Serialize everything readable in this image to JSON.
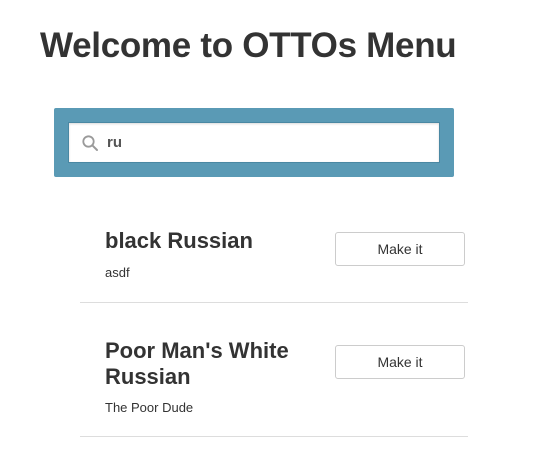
{
  "header": {
    "title": "Welcome to OTTOs Menu"
  },
  "search": {
    "icon": "search-icon",
    "value": "ru",
    "placeholder": ""
  },
  "results": [
    {
      "title": "black Russian",
      "description": "asdf",
      "button_label": "Make it"
    },
    {
      "title": "Poor Man's White Russian",
      "description": "The Poor Dude",
      "button_label": "Make it"
    }
  ],
  "colors": {
    "search_panel": "#5a9ab5",
    "divider": "#dddddd",
    "text": "#333333"
  }
}
